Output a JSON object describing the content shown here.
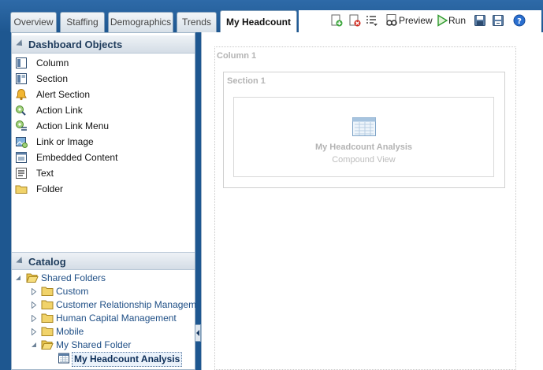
{
  "tabs": [
    {
      "label": "Overview"
    },
    {
      "label": "Staffing"
    },
    {
      "label": "Demographics"
    },
    {
      "label": "Trends"
    },
    {
      "label": "My Headcount"
    }
  ],
  "toolbar": {
    "preview_label": "Preview",
    "run_label": "Run"
  },
  "dashboard_objects": {
    "title": "Dashboard Objects",
    "items": [
      {
        "label": "Column",
        "icon": "column-icon"
      },
      {
        "label": "Section",
        "icon": "section-icon"
      },
      {
        "label": "Alert Section",
        "icon": "alert-bell-icon"
      },
      {
        "label": "Action Link",
        "icon": "action-link-icon"
      },
      {
        "label": "Action Link Menu",
        "icon": "action-link-menu-icon"
      },
      {
        "label": "Link or Image",
        "icon": "link-image-icon"
      },
      {
        "label": "Embedded Content",
        "icon": "embedded-content-icon"
      },
      {
        "label": "Text",
        "icon": "text-icon"
      },
      {
        "label": "Folder",
        "icon": "folder-icon"
      }
    ]
  },
  "catalog": {
    "title": "Catalog",
    "root": "Shared Folders",
    "folders": [
      {
        "label": "Custom"
      },
      {
        "label": "Customer Relationship Management"
      },
      {
        "label": "Human Capital Management"
      },
      {
        "label": "Mobile"
      },
      {
        "label": "My Shared Folder"
      }
    ],
    "selected_item": "My Headcount Analysis"
  },
  "canvas": {
    "column_title": "Column 1",
    "section_title": "Section 1",
    "analysis_title": "My Headcount Analysis",
    "analysis_subtitle": "Compound View"
  },
  "colors": {
    "background": "#1e5790",
    "header_text": "#1f3c5c",
    "catalog_link": "#1f4f86",
    "run_green": "#2e9a2e",
    "delete_red": "#d02a1e",
    "help_blue": "#2a6fd0"
  }
}
